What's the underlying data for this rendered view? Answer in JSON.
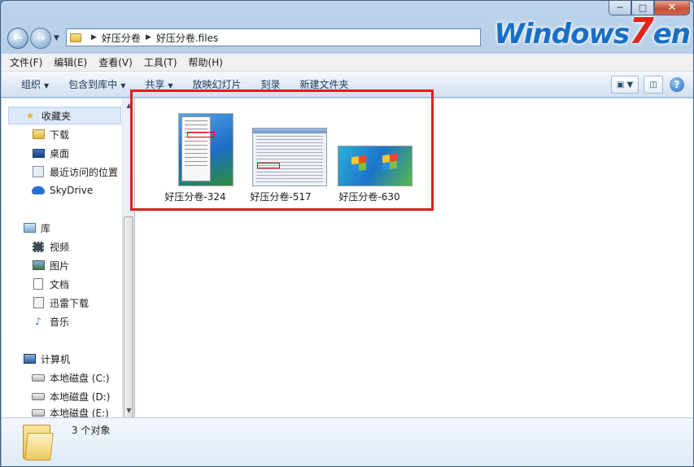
{
  "window": {
    "caption": {
      "minimize": "─",
      "maximize": "□",
      "close": "✕"
    },
    "brand": {
      "prefix": "Windows",
      "seven": "7",
      "suffix": "en"
    }
  },
  "nav": {
    "back_icon": "arrow-left-icon",
    "forward_icon": "arrow-right-icon",
    "breadcrumb": [
      "好压分卷",
      "好压分卷.files"
    ]
  },
  "menubar": {
    "items": [
      "文件(F)",
      "编辑(E)",
      "查看(V)",
      "工具(T)",
      "帮助(H)"
    ]
  },
  "commandbar": {
    "organize": "组织",
    "include_library": "包含到库中",
    "share": "共享",
    "slideshow": "放映幻灯片",
    "burn": "刻录",
    "new_folder": "新建文件夹",
    "help": "?"
  },
  "sidebar": {
    "favorites": {
      "label": "收藏夹",
      "items": [
        "下载",
        "桌面",
        "最近访问的位置",
        "SkyDrive"
      ]
    },
    "libraries": {
      "label": "库",
      "items": [
        "视频",
        "图片",
        "文档",
        "迅雷下载",
        "音乐"
      ]
    },
    "computer": {
      "label": "计算机",
      "items": [
        "本地磁盘 (C:)",
        "本地磁盘 (D:)",
        "本地磁盘 (E:)"
      ]
    }
  },
  "files": [
    {
      "name": "好压分卷-324"
    },
    {
      "name": "好压分卷-517"
    },
    {
      "name": "好压分卷-630"
    }
  ],
  "details": {
    "count": "3 个对象"
  },
  "colors": {
    "highlight_box": "#e01c1c",
    "frame": "#a9c4e2",
    "brand_blue": "#1a6fc4",
    "brand_red": "#e0261c"
  }
}
